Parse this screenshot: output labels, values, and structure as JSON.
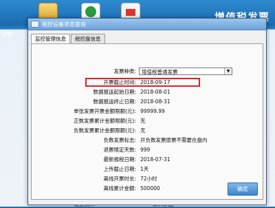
{
  "app": {
    "title": "增值税发票",
    "left_label": "设置",
    "bottom_left": "发票资料",
    "bottom_mid": "资料价出"
  },
  "dialog": {
    "title": "税控设备状态查询",
    "ok_label": "确定"
  },
  "tabs": [
    "监控管理信息",
    "税控盘信息"
  ],
  "invoice_type": {
    "label": "发票种类:",
    "value": "增值税普通发票"
  },
  "fields": [
    {
      "label": "开票截止时间:",
      "value": "2018-09-17"
    },
    {
      "label": "数据报送起始日期:",
      "value": "2018-08-01"
    },
    {
      "label": "数据报送终止日期:",
      "value": "2018-08-31"
    },
    {
      "label": "单张发票开票金额限额(元):",
      "value": "99999.99"
    },
    {
      "label": "正数发票累计金额限额(元):",
      "value": "无"
    },
    {
      "label": "负数发票累计金额限额(元):",
      "value": "无"
    },
    {
      "label": "负数发票标志:",
      "value": "开负数发票原票不需要在盘内"
    },
    {
      "label": "退票限定天数:",
      "value": "999"
    },
    {
      "label": "最新报税日期:",
      "value": "2018-07-31"
    },
    {
      "label": "上传截止日期:",
      "value": "1天"
    },
    {
      "label": "离线开票时长:",
      "value": "72小时"
    },
    {
      "label": "离线累计金额:",
      "value": "500000"
    }
  ]
}
